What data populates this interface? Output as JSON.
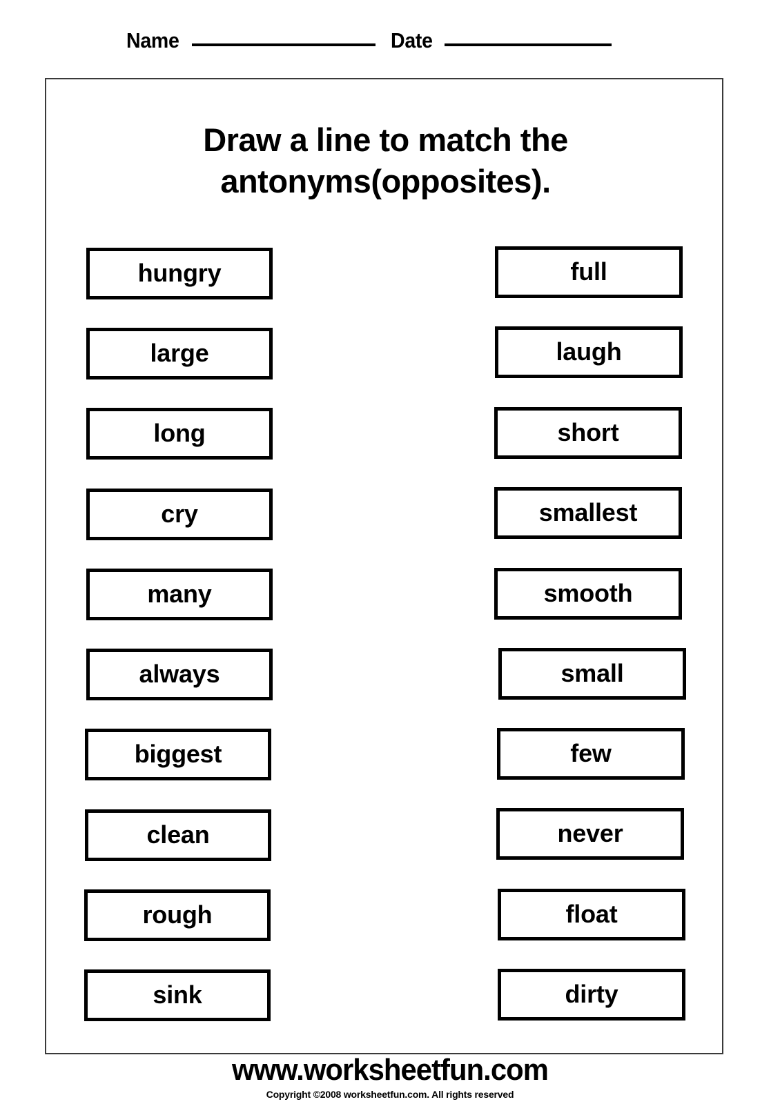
{
  "header": {
    "name_label": "Name",
    "date_label": "Date"
  },
  "title": {
    "line1": "Draw a line to match the",
    "line2": "antonyms(opposites).",
    "full": "Draw a line to match the antonyms(opposites)."
  },
  "columns": {
    "left": [
      {
        "word": "hungry"
      },
      {
        "word": "large"
      },
      {
        "word": "long"
      },
      {
        "word": "cry"
      },
      {
        "word": "many"
      },
      {
        "word": "always"
      },
      {
        "word": "biggest"
      },
      {
        "word": "clean"
      },
      {
        "word": "rough"
      },
      {
        "word": "sink"
      }
    ],
    "right": [
      {
        "word": "full"
      },
      {
        "word": "laugh"
      },
      {
        "word": "short"
      },
      {
        "word": "smallest"
      },
      {
        "word": "smooth"
      },
      {
        "word": "small"
      },
      {
        "word": "few"
      },
      {
        "word": "never"
      },
      {
        "word": "float"
      },
      {
        "word": "dirty"
      }
    ]
  },
  "footer": {
    "site": "www.worksheetfun.com",
    "copyright": "Copyright ©2008 worksheetfun.com. All rights reserved"
  },
  "colors": {
    "ink": "#000000",
    "frame": "#3a3a3a",
    "paper": "#ffffff"
  }
}
